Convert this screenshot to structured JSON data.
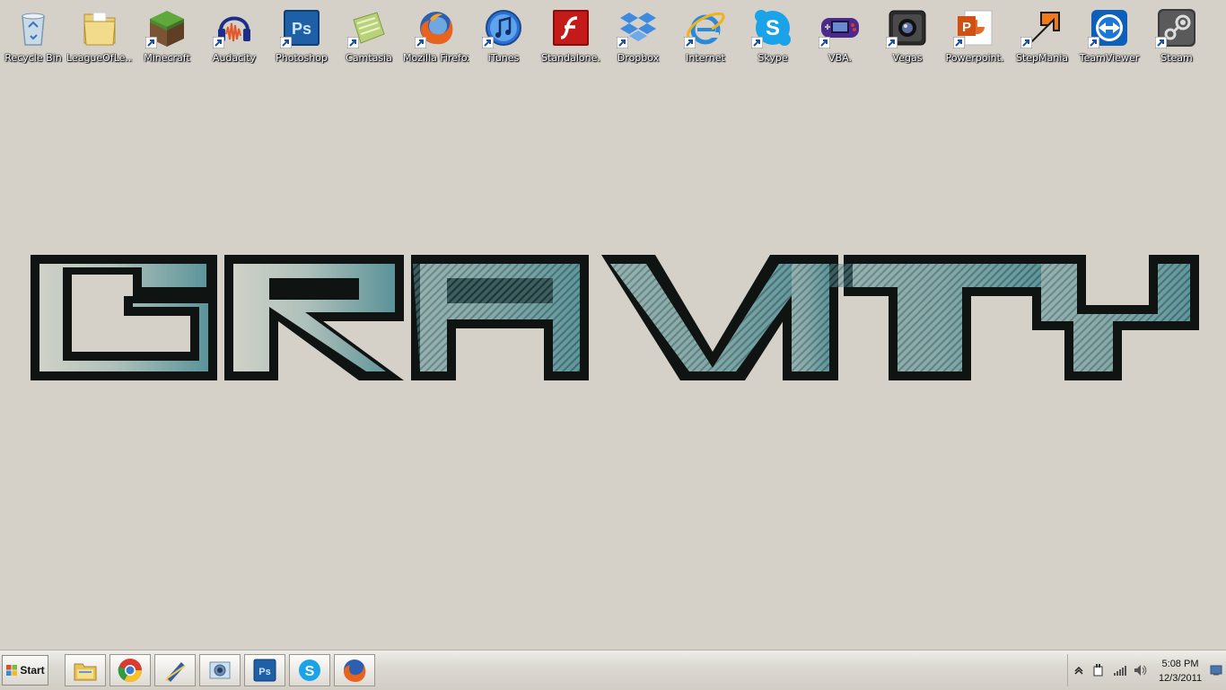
{
  "desktop": {
    "icons": [
      {
        "label": "Recycle Bin",
        "icon": "recycle-bin-icon",
        "shortcut": false
      },
      {
        "label": "LeagueOfLe...",
        "icon": "folder-icon",
        "shortcut": false
      },
      {
        "label": "Minecraft",
        "icon": "minecraft-icon",
        "shortcut": true
      },
      {
        "label": "Audacity",
        "icon": "audacity-icon",
        "shortcut": true
      },
      {
        "label": "Photoshop",
        "icon": "photoshop-icon",
        "shortcut": true
      },
      {
        "label": "Camtasia",
        "icon": "camtasia-icon",
        "shortcut": true
      },
      {
        "label": "Mozilla Firefox",
        "icon": "firefox-icon",
        "shortcut": true
      },
      {
        "label": "iTunes",
        "icon": "itunes-icon",
        "shortcut": true
      },
      {
        "label": "Standalone.",
        "icon": "flash-icon",
        "shortcut": false
      },
      {
        "label": "Dropbox",
        "icon": "dropbox-icon",
        "shortcut": true
      },
      {
        "label": "Internet",
        "icon": "internet-explorer-icon",
        "shortcut": true
      },
      {
        "label": "Skype",
        "icon": "skype-icon",
        "shortcut": true
      },
      {
        "label": "VBA.",
        "icon": "vba-gameboy-icon",
        "shortcut": true
      },
      {
        "label": "Vegas",
        "icon": "vegas-icon",
        "shortcut": true
      },
      {
        "label": "Powerpoint.",
        "icon": "powerpoint-icon",
        "shortcut": true
      },
      {
        "label": "StepMania",
        "icon": "stepmania-icon",
        "shortcut": true
      },
      {
        "label": "TeamViewer",
        "icon": "teamviewer-icon",
        "shortcut": true
      },
      {
        "label": "Steam",
        "icon": "steam-icon",
        "shortcut": true
      }
    ]
  },
  "wallpaper": {
    "logo_text": "GRAVITY"
  },
  "taskbar": {
    "start_label": "Start",
    "pinned": [
      {
        "icon": "windows-explorer-icon"
      },
      {
        "icon": "chrome-icon"
      },
      {
        "icon": "pen-tool-icon"
      },
      {
        "icon": "photo-viewer-icon"
      },
      {
        "icon": "photoshop-icon"
      },
      {
        "icon": "skype-icon"
      },
      {
        "icon": "firefox-icon"
      }
    ],
    "tray": {
      "time": "5:08 PM",
      "date": "12/3/2011",
      "icons": [
        "show-hidden-icons-icon",
        "power-plug-icon",
        "network-signal-icon",
        "volume-icon",
        "show-desktop-icon"
      ]
    }
  },
  "colors": {
    "desktop_bg": "#d5d1c9",
    "logo_dark": "#0f1412",
    "logo_teal": "#5f9aa0"
  }
}
